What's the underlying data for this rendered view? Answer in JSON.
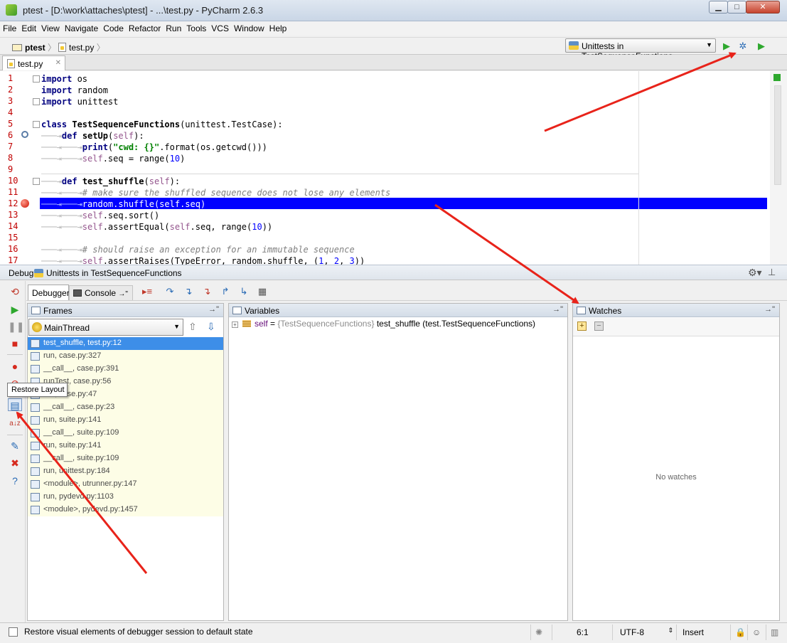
{
  "window": {
    "title": "ptest - [D:\\work\\attaches\\ptest] - ...\\test.py - PyCharm 2.6.3",
    "min_glyph": "▁",
    "max_glyph": "□",
    "close_glyph": "✕"
  },
  "menu": [
    "File",
    "Edit",
    "View",
    "Navigate",
    "Code",
    "Refactor",
    "Run",
    "Tools",
    "VCS",
    "Window",
    "Help"
  ],
  "navbar": {
    "project": "ptest",
    "file": "test.py",
    "run_config": "Unittests in TestSequenceFunctions"
  },
  "editor": {
    "tab": "test.py",
    "line_numbers": [
      "1",
      "2",
      "3",
      "4",
      "5",
      "6",
      "7",
      "8",
      "9",
      "10",
      "11",
      "12",
      "13",
      "14",
      "15",
      "16",
      "17"
    ],
    "current_line": 12,
    "breakpoint_line": 12
  },
  "debug": {
    "label": "Debug",
    "config": "Unittests in TestSequenceFunctions",
    "tabs": {
      "debugger": "Debugger",
      "console": "Console"
    }
  },
  "frames": {
    "title": "Frames",
    "thread": "MainThread",
    "items": [
      "test_shuffle, test.py:12",
      "run, case.py:327",
      "__call__, case.py:391",
      "runTest, case.py:56",
      "run, case.py:47",
      "__call__, case.py:23",
      "run, suite.py:141",
      "__call__, suite.py:109",
      "run, suite.py:141",
      "__call__, suite.py:109",
      "run, unittest.py:184",
      "<module>, utrunner.py:147",
      "run, pydevd.py:1103",
      "<module>, pydevd.py:1457"
    ],
    "selected_index": 0
  },
  "variables": {
    "title": "Variables",
    "row": {
      "name": "self",
      "eq": " = ",
      "type": "{TestSequenceFunctions}",
      "value": " test_shuffle (test.TestSequenceFunctions)"
    }
  },
  "watches": {
    "title": "Watches",
    "empty_text": "No watches"
  },
  "tooltip": "Restore Layout",
  "status": {
    "message": "Restore visual elements of debugger session to default state",
    "position": "6:1",
    "encoding": "UTF-8",
    "mode": "Insert"
  },
  "colors": {
    "current_line": "#0000ff",
    "selected_frame": "#3d8ee8",
    "frame_bg": "#fdfde6",
    "annotation_arrow": "#e8231a"
  }
}
